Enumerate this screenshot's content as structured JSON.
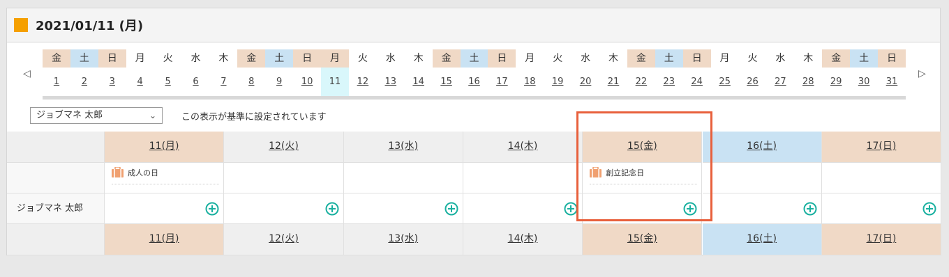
{
  "header": {
    "title": "2021/01/11 (月)",
    "accent": "#f5a000"
  },
  "nav": {
    "prev_glyph": "◁",
    "next_glyph": "▷"
  },
  "date_strip": [
    {
      "dow": "金",
      "num": "1",
      "type": "fri"
    },
    {
      "dow": "土",
      "num": "2",
      "type": "sat"
    },
    {
      "dow": "日",
      "num": "3",
      "type": "sun"
    },
    {
      "dow": "月",
      "num": "4",
      "type": ""
    },
    {
      "dow": "火",
      "num": "5",
      "type": ""
    },
    {
      "dow": "水",
      "num": "6",
      "type": ""
    },
    {
      "dow": "木",
      "num": "7",
      "type": ""
    },
    {
      "dow": "金",
      "num": "8",
      "type": "fri"
    },
    {
      "dow": "土",
      "num": "9",
      "type": "sat"
    },
    {
      "dow": "日",
      "num": "10",
      "type": "sun"
    },
    {
      "dow": "月",
      "num": "11",
      "type": "sun",
      "selected": true
    },
    {
      "dow": "火",
      "num": "12",
      "type": ""
    },
    {
      "dow": "水",
      "num": "13",
      "type": ""
    },
    {
      "dow": "木",
      "num": "14",
      "type": ""
    },
    {
      "dow": "金",
      "num": "15",
      "type": "fri"
    },
    {
      "dow": "土",
      "num": "16",
      "type": "sat"
    },
    {
      "dow": "日",
      "num": "17",
      "type": "sun"
    },
    {
      "dow": "月",
      "num": "18",
      "type": ""
    },
    {
      "dow": "火",
      "num": "19",
      "type": ""
    },
    {
      "dow": "水",
      "num": "20",
      "type": ""
    },
    {
      "dow": "木",
      "num": "21",
      "type": ""
    },
    {
      "dow": "金",
      "num": "22",
      "type": "fri"
    },
    {
      "dow": "土",
      "num": "23",
      "type": "sat"
    },
    {
      "dow": "日",
      "num": "24",
      "type": "sun"
    },
    {
      "dow": "月",
      "num": "25",
      "type": ""
    },
    {
      "dow": "火",
      "num": "26",
      "type": ""
    },
    {
      "dow": "水",
      "num": "27",
      "type": ""
    },
    {
      "dow": "木",
      "num": "28",
      "type": ""
    },
    {
      "dow": "金",
      "num": "29",
      "type": "fri"
    },
    {
      "dow": "土",
      "num": "30",
      "type": "sat"
    },
    {
      "dow": "日",
      "num": "31",
      "type": "sun"
    }
  ],
  "user_select": {
    "value": "ジョブマネ 太郎",
    "chevron": "⌄"
  },
  "base_note": "この表示が基準に設定されています",
  "week": {
    "days": [
      {
        "label": "11(月)",
        "type": "sun",
        "holiday": "成人の日"
      },
      {
        "label": "12(火)",
        "type": "",
        "holiday": ""
      },
      {
        "label": "13(水)",
        "type": "",
        "holiday": ""
      },
      {
        "label": "14(木)",
        "type": "",
        "holiday": ""
      },
      {
        "label": "15(金)",
        "type": "fri",
        "holiday": "創立記念日"
      },
      {
        "label": "16(土)",
        "type": "sat",
        "holiday": ""
      },
      {
        "label": "17(日)",
        "type": "sun",
        "holiday": ""
      }
    ],
    "user_label": "ジョブマネ 太郎"
  },
  "colors": {
    "holiday_header": "#f0d9c6",
    "saturday_header": "#c9e2f3",
    "selected_day": "#d9f7fb",
    "add_icon": "#1ab0a0",
    "holiday_icon": "#f0a070",
    "highlight_border": "#e8603c"
  }
}
